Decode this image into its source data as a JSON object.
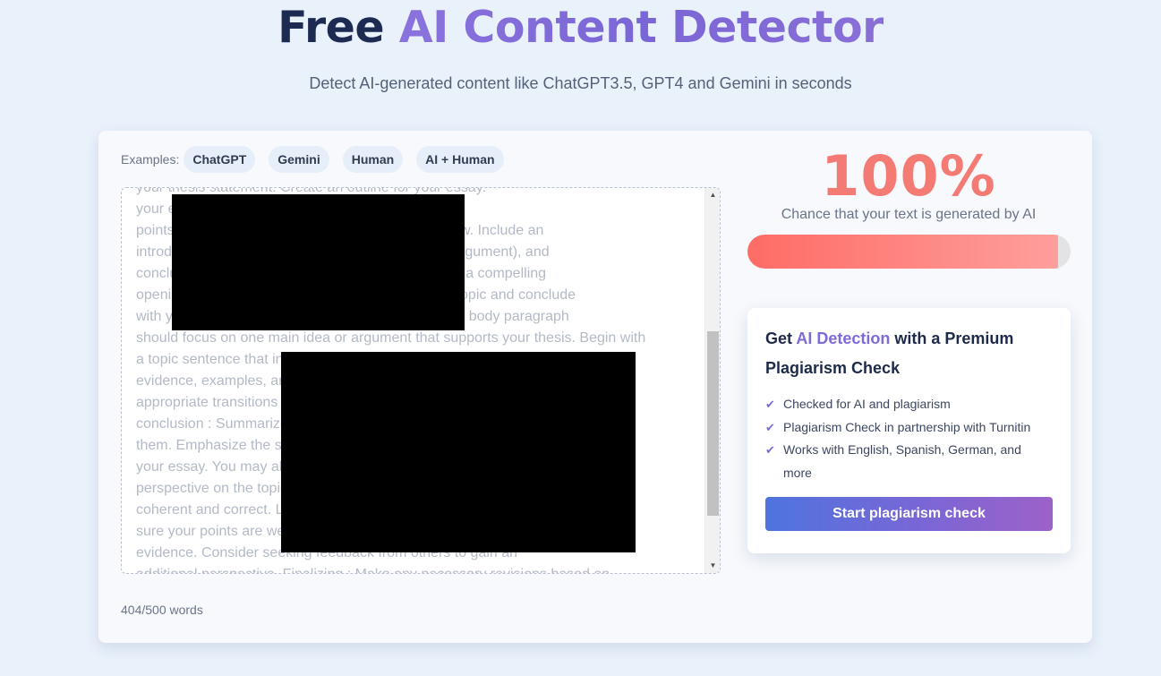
{
  "hero": {
    "title_dark": "Free",
    "title_accent": "AI Content Detector",
    "subtitle": "Detect AI-generated content like ChatGPT3.5, GPT4 and Gemini in seconds"
  },
  "examples": {
    "label": "Examples:",
    "chips": [
      "ChatGPT",
      "Gemini",
      "Human",
      "AI + Human"
    ]
  },
  "editor": {
    "lines": [
      "your thesis statement. Create an outline for your essay.",
      "your essay. This will help you arrange your",
      "points in a logical order and maintain a coherent flow. Include an",
      "introduction, body paragraphs (each main idea or argument), and",
      "conclusion. Introduction : Engage your readers with a compelling",
      "opening. Provide some background info about the topic and conclude",
      "with your thesis statement. Body Paragraphs : Each body paragraph",
      "should focus on one main idea or argument that supports your thesis. Begin with",
      "a topic sentence that introduces the main idea of the paragraph. Provide",
      "evidence, examples, and analysis to support your claims. use",
      "appropriate transitions between paragraphs to maintain flow. a",
      "conclusion : Summarize your main points without simply restate",
      "them. Emphasize the significance of your argument and make sure for",
      "your essay. You may also offer recommendations or suggest a broader",
      "perspective on the topic. Revise : check your essay to ensure it is",
      "coherent and correct. Look for errors in grammar and spelling. Make",
      "sure your points are well organized and supported with enough",
      "evidence. Consider seeking feedback from others to gain an",
      "additional perspective. Finalizing : Make any necessary revisions based on"
    ],
    "word_count": "404/500 words",
    "scroll_up": "▲",
    "scroll_down": "▼"
  },
  "result": {
    "score": "100%",
    "score_fraction": 0.96,
    "caption": "Chance that your text is generated by AI"
  },
  "promo": {
    "title_pre": "Get",
    "title_accent": "AI Detection",
    "title_post": "with a Premium Plagiarism Check",
    "features": [
      "Checked for AI and plagiarism",
      "Plagiarism Check in partnership with Turnitin",
      "Works with English, Spanish, German, and more"
    ],
    "check_glyph": "✔",
    "cta_label": "Start plagiarism check"
  },
  "colors": {
    "accent": "#7f6bd8",
    "score": "#f47a74",
    "meter": "#fe6c66",
    "background": "#e9f1fb"
  }
}
